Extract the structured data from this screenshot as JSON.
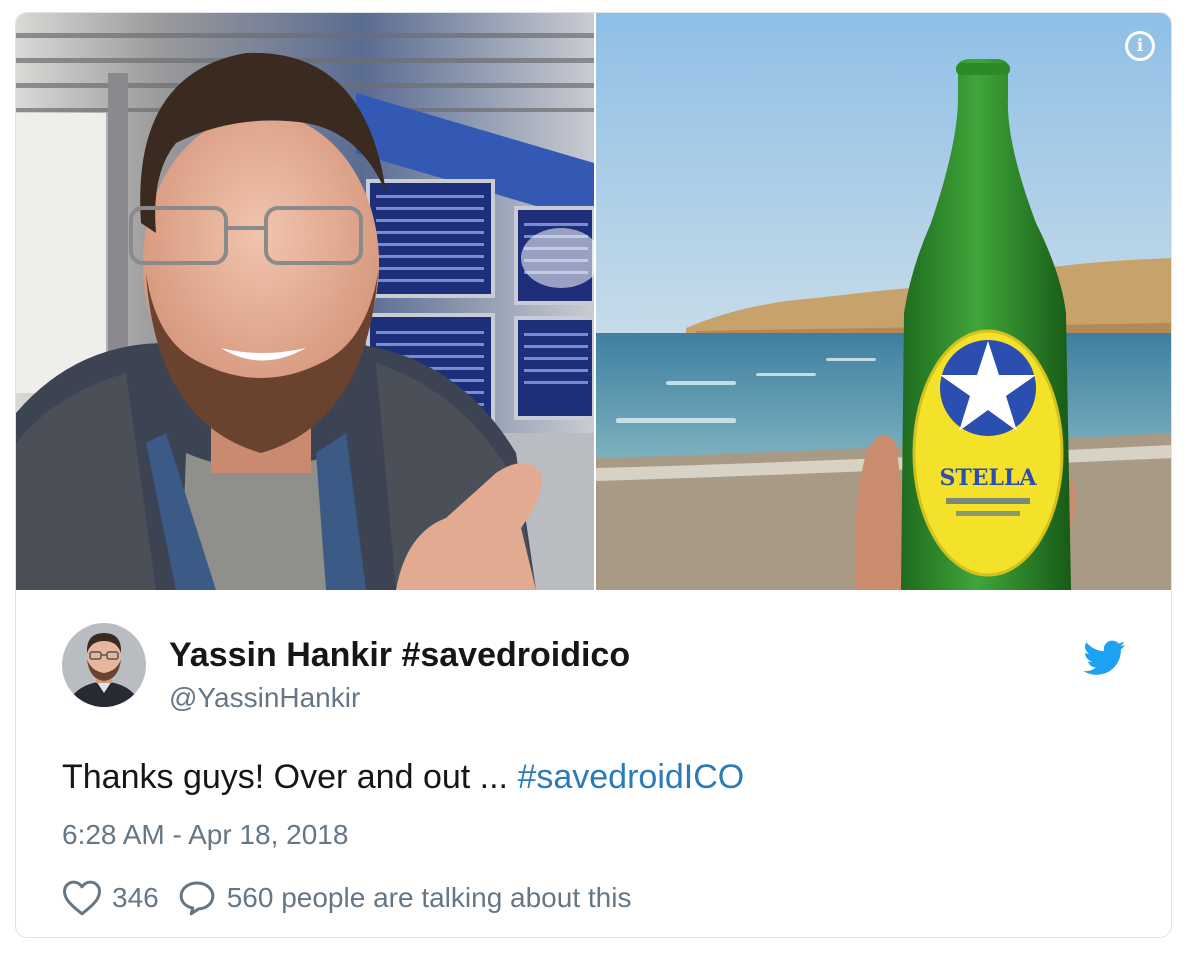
{
  "tweet": {
    "display_name": "Yassin Hankir #savedroidico",
    "handle": "@YassinHankir",
    "text": "Thanks guys! Over and out ... ",
    "hashtag": "#savedroidICO",
    "timestamp": "6:28 AM - Apr 18, 2018",
    "like_count": "346",
    "talking_text": "560 people are talking about this"
  },
  "media": {
    "bottle_label": "STELLA"
  },
  "icons": {
    "info": "info-icon",
    "bird": "twitter-bird-icon",
    "like": "heart-icon",
    "reply": "speech-bubble-icon"
  },
  "colors": {
    "name_text": "#14171a",
    "secondary_text": "#657786",
    "hashtag": "#2b7bb9",
    "twitter_blue": "#1da1f2",
    "card_border": "#dfe3e7"
  }
}
